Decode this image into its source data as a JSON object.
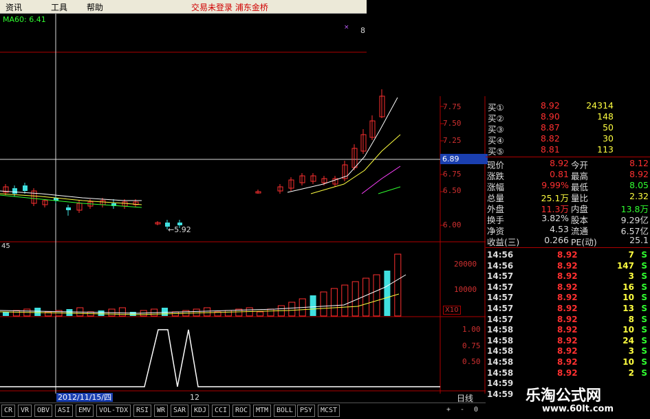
{
  "menu": {
    "items": [
      "资讯",
      "工具",
      "帮助"
    ],
    "alert": "交易未登录 浦东金桥"
  },
  "indicator": {
    "ma_label": "MA60: 6.41",
    "marker": "8"
  },
  "price_axis": {
    "ticks": [
      "7.75",
      "7.50",
      "7.25",
      "6.75",
      "6.50",
      "6.00"
    ],
    "current": "6.89",
    "low_label": "←5.92"
  },
  "volume_panel": {
    "label": "45",
    "ticks": [
      "20000",
      "10000"
    ],
    "unit": "X10"
  },
  "oscillator": {
    "ticks": [
      "1.00",
      "0.75",
      "0.50"
    ]
  },
  "date_bar": {
    "date": "2012/11/15/四",
    "month": "12",
    "period": "日线"
  },
  "order_book": [
    {
      "label": "买①",
      "price": "8.92",
      "volume": "24314"
    },
    {
      "label": "买②",
      "price": "8.90",
      "volume": "148"
    },
    {
      "label": "买③",
      "price": "8.87",
      "volume": "50"
    },
    {
      "label": "买④",
      "price": "8.82",
      "volume": "30"
    },
    {
      "label": "买⑤",
      "price": "8.81",
      "volume": "113"
    }
  ],
  "stats": [
    {
      "k1": "现价",
      "v1": "8.92",
      "k2": "今开",
      "v2": "8.12"
    },
    {
      "k1": "涨跌",
      "v1": "0.81",
      "k2": "最高",
      "v2": "8.92"
    },
    {
      "k1": "涨幅",
      "v1": "9.99%",
      "k2": "最低",
      "v2": "8.05"
    },
    {
      "k1": "总量",
      "v1": "25.1万",
      "k2": "量比",
      "v2": "2.32"
    },
    {
      "k1": "外盘",
      "v1": "11.3万",
      "k2": "内盘",
      "v2": "13.8万"
    },
    {
      "k1": "换手",
      "v1": "3.82%",
      "k2": "股本",
      "v2": "9.29亿"
    },
    {
      "k1": "净资",
      "v1": "4.53",
      "k2": "流通",
      "v2": "6.57亿"
    },
    {
      "k1": "收益(三)",
      "v1": "0.266",
      "k2": "PE(动)",
      "v2": "25.1"
    }
  ],
  "ticks": [
    {
      "time": "14:56",
      "price": "8.92",
      "vol": "7",
      "side": "S"
    },
    {
      "time": "14:56",
      "price": "8.92",
      "vol": "147",
      "side": "S"
    },
    {
      "time": "14:57",
      "price": "8.92",
      "vol": "3",
      "side": "S"
    },
    {
      "time": "14:57",
      "price": "8.92",
      "vol": "16",
      "side": "S"
    },
    {
      "time": "14:57",
      "price": "8.92",
      "vol": "10",
      "side": "S"
    },
    {
      "time": "14:57",
      "price": "8.92",
      "vol": "13",
      "side": "S"
    },
    {
      "time": "14:57",
      "price": "8.92",
      "vol": "8",
      "side": "S"
    },
    {
      "time": "14:58",
      "price": "8.92",
      "vol": "10",
      "side": "S"
    },
    {
      "time": "14:58",
      "price": "8.92",
      "vol": "24",
      "side": "S"
    },
    {
      "time": "14:58",
      "price": "8.92",
      "vol": "3",
      "side": "S"
    },
    {
      "time": "14:58",
      "price": "8.92",
      "vol": "10",
      "side": "S"
    },
    {
      "time": "14:58",
      "price": "8.92",
      "vol": "2",
      "side": "S"
    },
    {
      "time": "14:59",
      "price": "",
      "vol": "",
      "side": ""
    },
    {
      "time": "14:59",
      "price": "",
      "vol": "",
      "side": ""
    }
  ],
  "tabs": [
    "CR",
    "VR",
    "OBV",
    "ASI",
    "EMV",
    "VOL-TDX",
    "RSI",
    "WR",
    "SAR",
    "KDJ",
    "CCI",
    "ROC",
    "MTM",
    "BOLL",
    "PSY",
    "MCST"
  ],
  "tab_controls": [
    "+",
    "-",
    "0"
  ],
  "watermark": {
    "title": "乐淘公式网",
    "url": "www.60lt.com"
  },
  "colors": {
    "up": "#ff3030",
    "down": "#40e0e0",
    "grid": "#b00000",
    "yellow": "#ffff40",
    "green": "#30ff30",
    "white": "#ffffff"
  }
}
